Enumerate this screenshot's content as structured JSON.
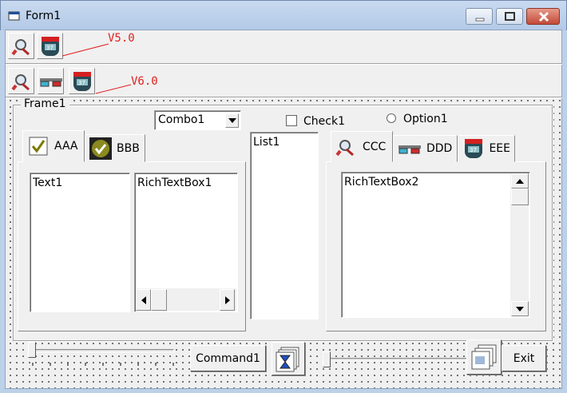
{
  "window": {
    "title": "Form1"
  },
  "toolbar1": {
    "version_label": "V5.0",
    "buttons": [
      "search-icon",
      "robot-icon"
    ]
  },
  "toolbar2": {
    "version_label": "V6.0",
    "buttons": [
      "search-icon",
      "glasses-icon",
      "robot-icon"
    ]
  },
  "frame": {
    "label": "Frame1"
  },
  "combo": {
    "value": "Combo1"
  },
  "check": {
    "label": "Check1",
    "checked": false
  },
  "option": {
    "label": "Option1",
    "selected": false
  },
  "tabs_left": [
    {
      "label": "AAA",
      "icon": "checkmark-doc-icon"
    },
    {
      "label": "BBB",
      "icon": "checkmark-circle-icon"
    }
  ],
  "text1": {
    "value": "Text1"
  },
  "richtext1": {
    "value": "RichTextBox1"
  },
  "list": {
    "items": [
      "List1"
    ]
  },
  "tabs_right": [
    {
      "label": "CCC",
      "icon": "search-icon"
    },
    {
      "label": "DDD",
      "icon": "glasses-icon"
    },
    {
      "label": "EEE",
      "icon": "robot-icon"
    }
  ],
  "richtext2": {
    "value": "RichTextBox2"
  },
  "command1": {
    "label": "Command1"
  },
  "exit": {
    "label": "Exit"
  },
  "colors": {
    "version_annotation": "#e02020",
    "window_frame": "#bcd0e8",
    "close_button": "#c24a38"
  }
}
